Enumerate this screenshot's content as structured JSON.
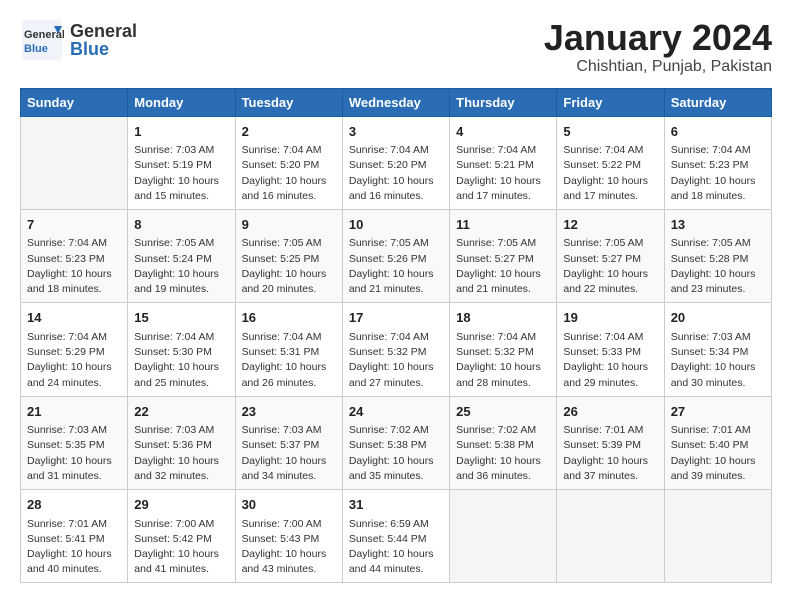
{
  "header": {
    "logo_general": "General",
    "logo_blue": "Blue",
    "title": "January 2024",
    "subtitle": "Chishtian, Punjab, Pakistan"
  },
  "calendar": {
    "days": [
      "Sunday",
      "Monday",
      "Tuesday",
      "Wednesday",
      "Thursday",
      "Friday",
      "Saturday"
    ],
    "weeks": [
      [
        {
          "num": "",
          "sunrise": "",
          "sunset": "",
          "daylight": ""
        },
        {
          "num": "1",
          "sunrise": "Sunrise: 7:03 AM",
          "sunset": "Sunset: 5:19 PM",
          "daylight": "Daylight: 10 hours and 15 minutes."
        },
        {
          "num": "2",
          "sunrise": "Sunrise: 7:04 AM",
          "sunset": "Sunset: 5:20 PM",
          "daylight": "Daylight: 10 hours and 16 minutes."
        },
        {
          "num": "3",
          "sunrise": "Sunrise: 7:04 AM",
          "sunset": "Sunset: 5:20 PM",
          "daylight": "Daylight: 10 hours and 16 minutes."
        },
        {
          "num": "4",
          "sunrise": "Sunrise: 7:04 AM",
          "sunset": "Sunset: 5:21 PM",
          "daylight": "Daylight: 10 hours and 17 minutes."
        },
        {
          "num": "5",
          "sunrise": "Sunrise: 7:04 AM",
          "sunset": "Sunset: 5:22 PM",
          "daylight": "Daylight: 10 hours and 17 minutes."
        },
        {
          "num": "6",
          "sunrise": "Sunrise: 7:04 AM",
          "sunset": "Sunset: 5:23 PM",
          "daylight": "Daylight: 10 hours and 18 minutes."
        }
      ],
      [
        {
          "num": "7",
          "sunrise": "Sunrise: 7:04 AM",
          "sunset": "Sunset: 5:23 PM",
          "daylight": "Daylight: 10 hours and 18 minutes."
        },
        {
          "num": "8",
          "sunrise": "Sunrise: 7:05 AM",
          "sunset": "Sunset: 5:24 PM",
          "daylight": "Daylight: 10 hours and 19 minutes."
        },
        {
          "num": "9",
          "sunrise": "Sunrise: 7:05 AM",
          "sunset": "Sunset: 5:25 PM",
          "daylight": "Daylight: 10 hours and 20 minutes."
        },
        {
          "num": "10",
          "sunrise": "Sunrise: 7:05 AM",
          "sunset": "Sunset: 5:26 PM",
          "daylight": "Daylight: 10 hours and 21 minutes."
        },
        {
          "num": "11",
          "sunrise": "Sunrise: 7:05 AM",
          "sunset": "Sunset: 5:27 PM",
          "daylight": "Daylight: 10 hours and 21 minutes."
        },
        {
          "num": "12",
          "sunrise": "Sunrise: 7:05 AM",
          "sunset": "Sunset: 5:27 PM",
          "daylight": "Daylight: 10 hours and 22 minutes."
        },
        {
          "num": "13",
          "sunrise": "Sunrise: 7:05 AM",
          "sunset": "Sunset: 5:28 PM",
          "daylight": "Daylight: 10 hours and 23 minutes."
        }
      ],
      [
        {
          "num": "14",
          "sunrise": "Sunrise: 7:04 AM",
          "sunset": "Sunset: 5:29 PM",
          "daylight": "Daylight: 10 hours and 24 minutes."
        },
        {
          "num": "15",
          "sunrise": "Sunrise: 7:04 AM",
          "sunset": "Sunset: 5:30 PM",
          "daylight": "Daylight: 10 hours and 25 minutes."
        },
        {
          "num": "16",
          "sunrise": "Sunrise: 7:04 AM",
          "sunset": "Sunset: 5:31 PM",
          "daylight": "Daylight: 10 hours and 26 minutes."
        },
        {
          "num": "17",
          "sunrise": "Sunrise: 7:04 AM",
          "sunset": "Sunset: 5:32 PM",
          "daylight": "Daylight: 10 hours and 27 minutes."
        },
        {
          "num": "18",
          "sunrise": "Sunrise: 7:04 AM",
          "sunset": "Sunset: 5:32 PM",
          "daylight": "Daylight: 10 hours and 28 minutes."
        },
        {
          "num": "19",
          "sunrise": "Sunrise: 7:04 AM",
          "sunset": "Sunset: 5:33 PM",
          "daylight": "Daylight: 10 hours and 29 minutes."
        },
        {
          "num": "20",
          "sunrise": "Sunrise: 7:03 AM",
          "sunset": "Sunset: 5:34 PM",
          "daylight": "Daylight: 10 hours and 30 minutes."
        }
      ],
      [
        {
          "num": "21",
          "sunrise": "Sunrise: 7:03 AM",
          "sunset": "Sunset: 5:35 PM",
          "daylight": "Daylight: 10 hours and 31 minutes."
        },
        {
          "num": "22",
          "sunrise": "Sunrise: 7:03 AM",
          "sunset": "Sunset: 5:36 PM",
          "daylight": "Daylight: 10 hours and 32 minutes."
        },
        {
          "num": "23",
          "sunrise": "Sunrise: 7:03 AM",
          "sunset": "Sunset: 5:37 PM",
          "daylight": "Daylight: 10 hours and 34 minutes."
        },
        {
          "num": "24",
          "sunrise": "Sunrise: 7:02 AM",
          "sunset": "Sunset: 5:38 PM",
          "daylight": "Daylight: 10 hours and 35 minutes."
        },
        {
          "num": "25",
          "sunrise": "Sunrise: 7:02 AM",
          "sunset": "Sunset: 5:38 PM",
          "daylight": "Daylight: 10 hours and 36 minutes."
        },
        {
          "num": "26",
          "sunrise": "Sunrise: 7:01 AM",
          "sunset": "Sunset: 5:39 PM",
          "daylight": "Daylight: 10 hours and 37 minutes."
        },
        {
          "num": "27",
          "sunrise": "Sunrise: 7:01 AM",
          "sunset": "Sunset: 5:40 PM",
          "daylight": "Daylight: 10 hours and 39 minutes."
        }
      ],
      [
        {
          "num": "28",
          "sunrise": "Sunrise: 7:01 AM",
          "sunset": "Sunset: 5:41 PM",
          "daylight": "Daylight: 10 hours and 40 minutes."
        },
        {
          "num": "29",
          "sunrise": "Sunrise: 7:00 AM",
          "sunset": "Sunset: 5:42 PM",
          "daylight": "Daylight: 10 hours and 41 minutes."
        },
        {
          "num": "30",
          "sunrise": "Sunrise: 7:00 AM",
          "sunset": "Sunset: 5:43 PM",
          "daylight": "Daylight: 10 hours and 43 minutes."
        },
        {
          "num": "31",
          "sunrise": "Sunrise: 6:59 AM",
          "sunset": "Sunset: 5:44 PM",
          "daylight": "Daylight: 10 hours and 44 minutes."
        },
        {
          "num": "",
          "sunrise": "",
          "sunset": "",
          "daylight": ""
        },
        {
          "num": "",
          "sunrise": "",
          "sunset": "",
          "daylight": ""
        },
        {
          "num": "",
          "sunrise": "",
          "sunset": "",
          "daylight": ""
        }
      ]
    ]
  }
}
